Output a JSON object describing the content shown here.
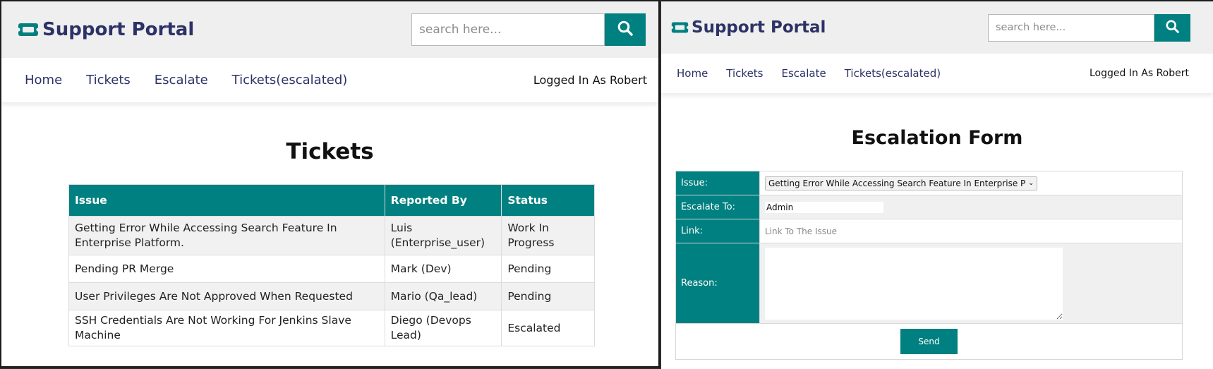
{
  "left": {
    "brand": {
      "name": "Support Portal",
      "icon": "ticket-icon"
    },
    "search": {
      "placeholder": "search here...",
      "icon": "search-icon"
    },
    "nav": {
      "links": [
        "Home",
        "Tickets",
        "Escalate",
        "Tickets(escalated)"
      ],
      "user": "Logged In As Robert"
    },
    "page_title": "Tickets",
    "table": {
      "headers": [
        "Issue",
        "Reported By",
        "Status"
      ],
      "rows": [
        {
          "issue": "Getting Error While Accessing Search Feature In Enterprise Platform.",
          "reported_by": "Luis (Enterprise_user)",
          "status": "Work In Progress"
        },
        {
          "issue": "Pending PR Merge",
          "reported_by": "Mark (Dev)",
          "status": "Pending"
        },
        {
          "issue": "User Privileges Are Not Approved When Requested",
          "reported_by": "Mario (Qa_lead)",
          "status": "Pending"
        },
        {
          "issue": "SSH Credentials Are Not Working For Jenkins Slave Machine",
          "reported_by": "Diego (Devops Lead)",
          "status": "Escalated"
        }
      ]
    }
  },
  "right": {
    "brand": {
      "name": "Support Portal",
      "icon": "ticket-icon"
    },
    "search": {
      "placeholder": "search here...",
      "icon": "search-icon"
    },
    "nav": {
      "links": [
        "Home",
        "Tickets",
        "Escalate",
        "Tickets(escalated)"
      ],
      "user": "Logged In As Robert"
    },
    "page_title": "Escalation Form",
    "form": {
      "issue_label": "Issue:",
      "issue_selected": "Getting Error While Accessing Search Feature In Enterprise Platform.",
      "escalate_label": "Escalate To:",
      "escalate_value": "Admin",
      "link_label": "Link:",
      "link_placeholder": "Link To The Issue",
      "reason_label": "Reason:",
      "reason_value": "",
      "send_label": "Send"
    }
  },
  "colors": {
    "accent": "#008080",
    "brand_text": "#2c3266",
    "header_bg": "#efefef"
  }
}
